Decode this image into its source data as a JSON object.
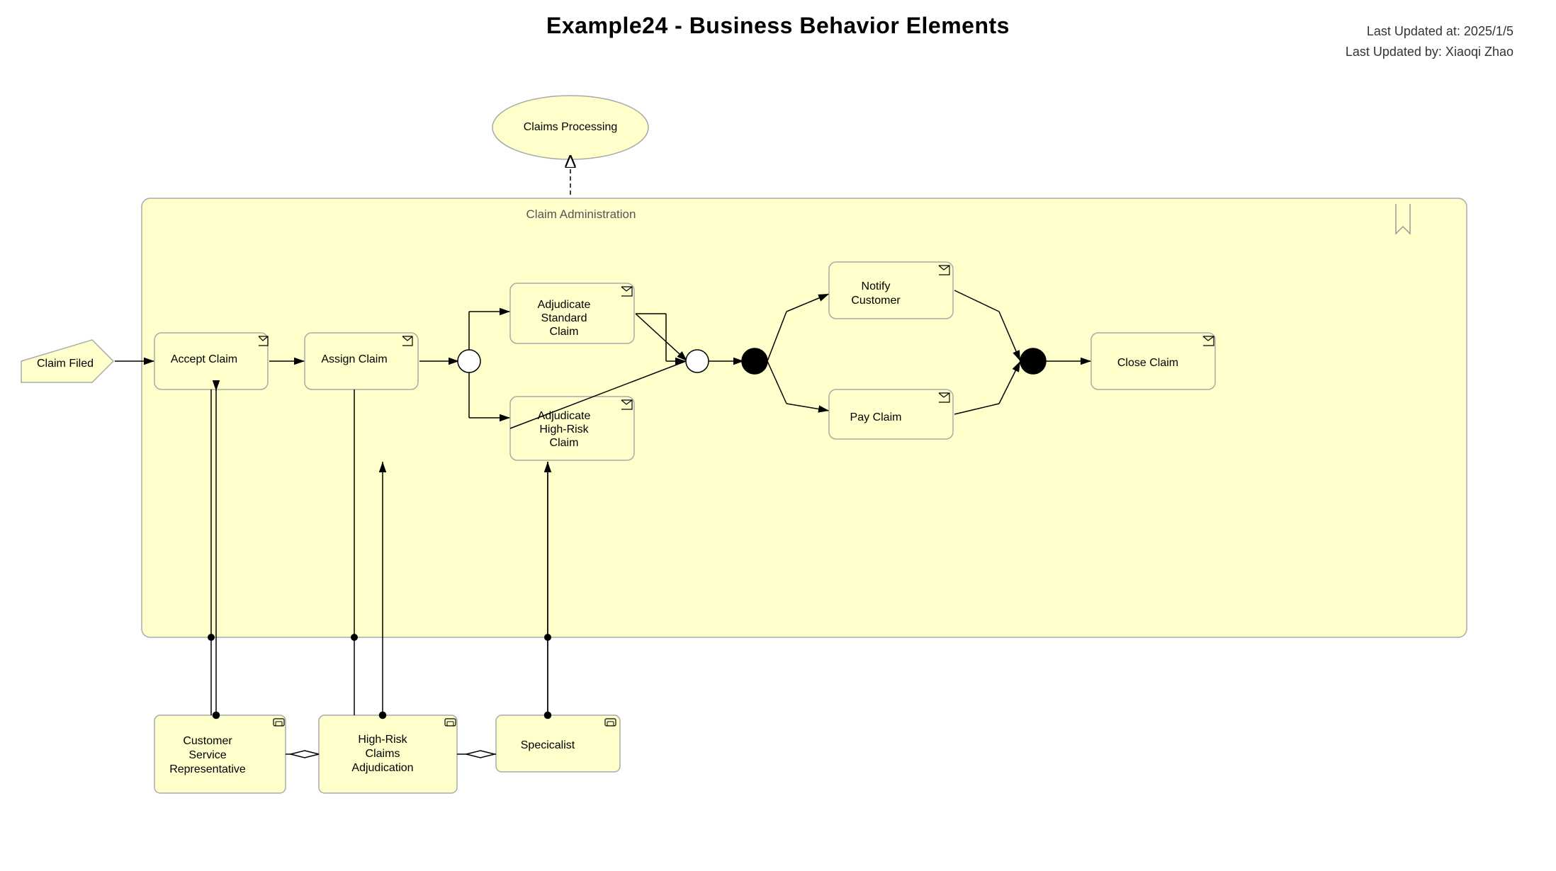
{
  "title": "Example24 - Business Behavior Elements",
  "meta": {
    "last_updated_at": "Last Updated at: 2025/1/5",
    "last_updated_by": "Last Updated by: Xiaoqi Zhao"
  },
  "nodes": {
    "claims_processing": "Claims Processing",
    "claim_administration": "Claim Administration",
    "claim_filed": "Claim Filed",
    "accept_claim": "Accept Claim",
    "assign_claim": "Assign Claim",
    "adjudicate_standard": "Adjudicate Standard Claim",
    "adjudicate_highrisk": "Adjudicate High-Risk Claim",
    "notify_customer": "Notify Customer",
    "pay_claim": "Pay Claim",
    "close_claim": "Close Claim",
    "customer_service_rep": "Customer Service Representative",
    "highrisk_claims_adj": "High-Risk Claims Adjudication",
    "specialist": "Specicalist"
  }
}
